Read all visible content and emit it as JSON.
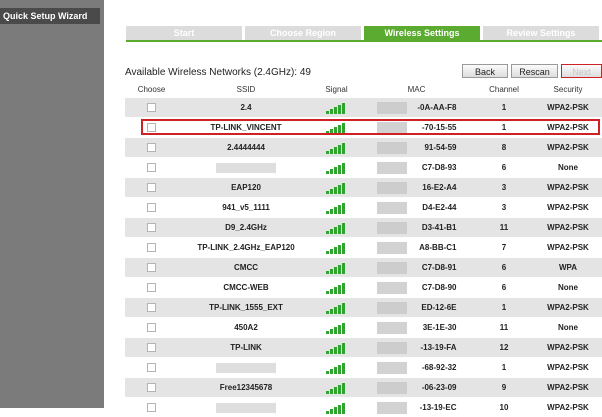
{
  "sidebar": {
    "items": [
      {
        "label": "Quick Setup Wizard"
      }
    ]
  },
  "steps": [
    {
      "label": "Start",
      "active": false
    },
    {
      "label": "Choose Region",
      "active": false
    },
    {
      "label": "Wireless Settings",
      "active": true
    },
    {
      "label": "Review Settings",
      "active": false
    }
  ],
  "available_label": "Available Wireless Networks (2.4GHz): 49",
  "buttons": {
    "back": "Back",
    "rescan": "Rescan",
    "next": "Next"
  },
  "table": {
    "headers": [
      "Choose",
      "SSID",
      "Signal",
      "MAC",
      "Channel",
      "Security"
    ],
    "rows": [
      {
        "ssid": "2.4",
        "signal": 5,
        "mac": "-0A-AA-F8",
        "channel": "1",
        "security": "WPA2-PSK"
      },
      {
        "ssid": "TP-LINK_VINCENT",
        "signal": 5,
        "mac": "-70-15-55",
        "channel": "1",
        "security": "WPA2-PSK"
      },
      {
        "ssid": "2.4444444",
        "signal": 5,
        "mac": "91-54-59",
        "channel": "8",
        "security": "WPA2-PSK"
      },
      {
        "ssid": "",
        "signal": 5,
        "mac": "C7-D8-93",
        "channel": "6",
        "security": "None"
      },
      {
        "ssid": "EAP120",
        "signal": 5,
        "mac": "16-E2-A4",
        "channel": "3",
        "security": "WPA2-PSK"
      },
      {
        "ssid": "941_v5_1111",
        "signal": 5,
        "mac": "D4-E2-44",
        "channel": "3",
        "security": "WPA2-PSK"
      },
      {
        "ssid": "D9_2.4GHz",
        "signal": 5,
        "mac": "D3-41-B1",
        "channel": "11",
        "security": "WPA2-PSK"
      },
      {
        "ssid": "TP-LINK_2.4GHz_EAP120",
        "signal": 5,
        "mac": "A8-BB-C1",
        "channel": "7",
        "security": "WPA2-PSK"
      },
      {
        "ssid": "CMCC",
        "signal": 5,
        "mac": "C7-D8-91",
        "channel": "6",
        "security": "WPA"
      },
      {
        "ssid": "CMCC-WEB",
        "signal": 5,
        "mac": "C7-D8-90",
        "channel": "6",
        "security": "None"
      },
      {
        "ssid": "TP-LINK_1555_EXT",
        "signal": 5,
        "mac": "ED-12-6E",
        "channel": "1",
        "security": "WPA2-PSK"
      },
      {
        "ssid": "450A2",
        "signal": 5,
        "mac": "3E-1E-30",
        "channel": "11",
        "security": "None"
      },
      {
        "ssid": "TP-LINK",
        "signal": 5,
        "mac": "-13-19-FA",
        "channel": "12",
        "security": "WPA2-PSK"
      },
      {
        "ssid": "",
        "signal": 5,
        "mac": "-68-92-32",
        "channel": "1",
        "security": "WPA2-PSK"
      },
      {
        "ssid": "Free12345678",
        "signal": 5,
        "mac": "-06-23-09",
        "channel": "9",
        "security": "WPA2-PSK"
      },
      {
        "ssid": "",
        "signal": 5,
        "mac": "-13-19-EC",
        "channel": "10",
        "security": "WPA2-PSK"
      }
    ]
  }
}
